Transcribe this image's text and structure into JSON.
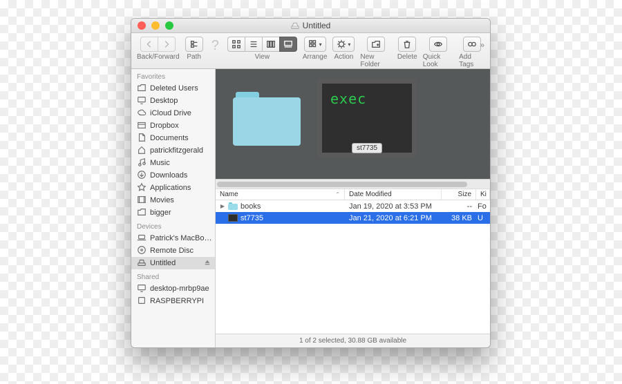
{
  "window": {
    "title": "Untitled"
  },
  "toolbar": {
    "back_forward_label": "Back/Forward",
    "path_label": "Path",
    "view_label": "View",
    "arrange_label": "Arrange",
    "action_label": "Action",
    "new_folder_label": "New Folder",
    "delete_label": "Delete",
    "quick_look_label": "Quick Look",
    "add_tags_label": "Add Tags"
  },
  "sidebar": {
    "sections": {
      "favorites": "Favorites",
      "devices": "Devices",
      "shared": "Shared"
    },
    "favorites": [
      {
        "icon": "folder",
        "label": "Deleted Users"
      },
      {
        "icon": "display",
        "label": "Desktop"
      },
      {
        "icon": "cloud",
        "label": "iCloud Drive"
      },
      {
        "icon": "box",
        "label": "Dropbox"
      },
      {
        "icon": "doc",
        "label": "Documents"
      },
      {
        "icon": "home",
        "label": "patrickfitzgerald"
      },
      {
        "icon": "music",
        "label": "Music"
      },
      {
        "icon": "download",
        "label": "Downloads"
      },
      {
        "icon": "app",
        "label": "Applications"
      },
      {
        "icon": "movie",
        "label": "Movies"
      },
      {
        "icon": "folder",
        "label": "bigger"
      }
    ],
    "devices": [
      {
        "icon": "laptop",
        "label": "Patrick's MacBo…"
      },
      {
        "icon": "disc",
        "label": "Remote Disc"
      },
      {
        "icon": "drive",
        "label": "Untitled",
        "selected": true,
        "eject": true
      }
    ],
    "shared": [
      {
        "icon": "display",
        "label": "desktop-mrbp9ae"
      },
      {
        "icon": "generic",
        "label": "RASPBERRYPI"
      }
    ]
  },
  "gallery": {
    "exec_text": "exec",
    "exec_label": "st7735"
  },
  "list": {
    "columns": {
      "name": "Name",
      "date": "Date Modified",
      "size": "Size",
      "kind": "Ki"
    },
    "rows": [
      {
        "type": "folder",
        "name": "books",
        "date": "Jan 19, 2020 at 3:53 PM",
        "size": "--",
        "kind": "Fo",
        "selected": false
      },
      {
        "type": "exec",
        "name": "st7735",
        "date": "Jan 21, 2020 at 6:21 PM",
        "size": "38 KB",
        "kind": "U",
        "selected": true
      }
    ]
  },
  "status": "1 of 2 selected, 30.88 GB available"
}
